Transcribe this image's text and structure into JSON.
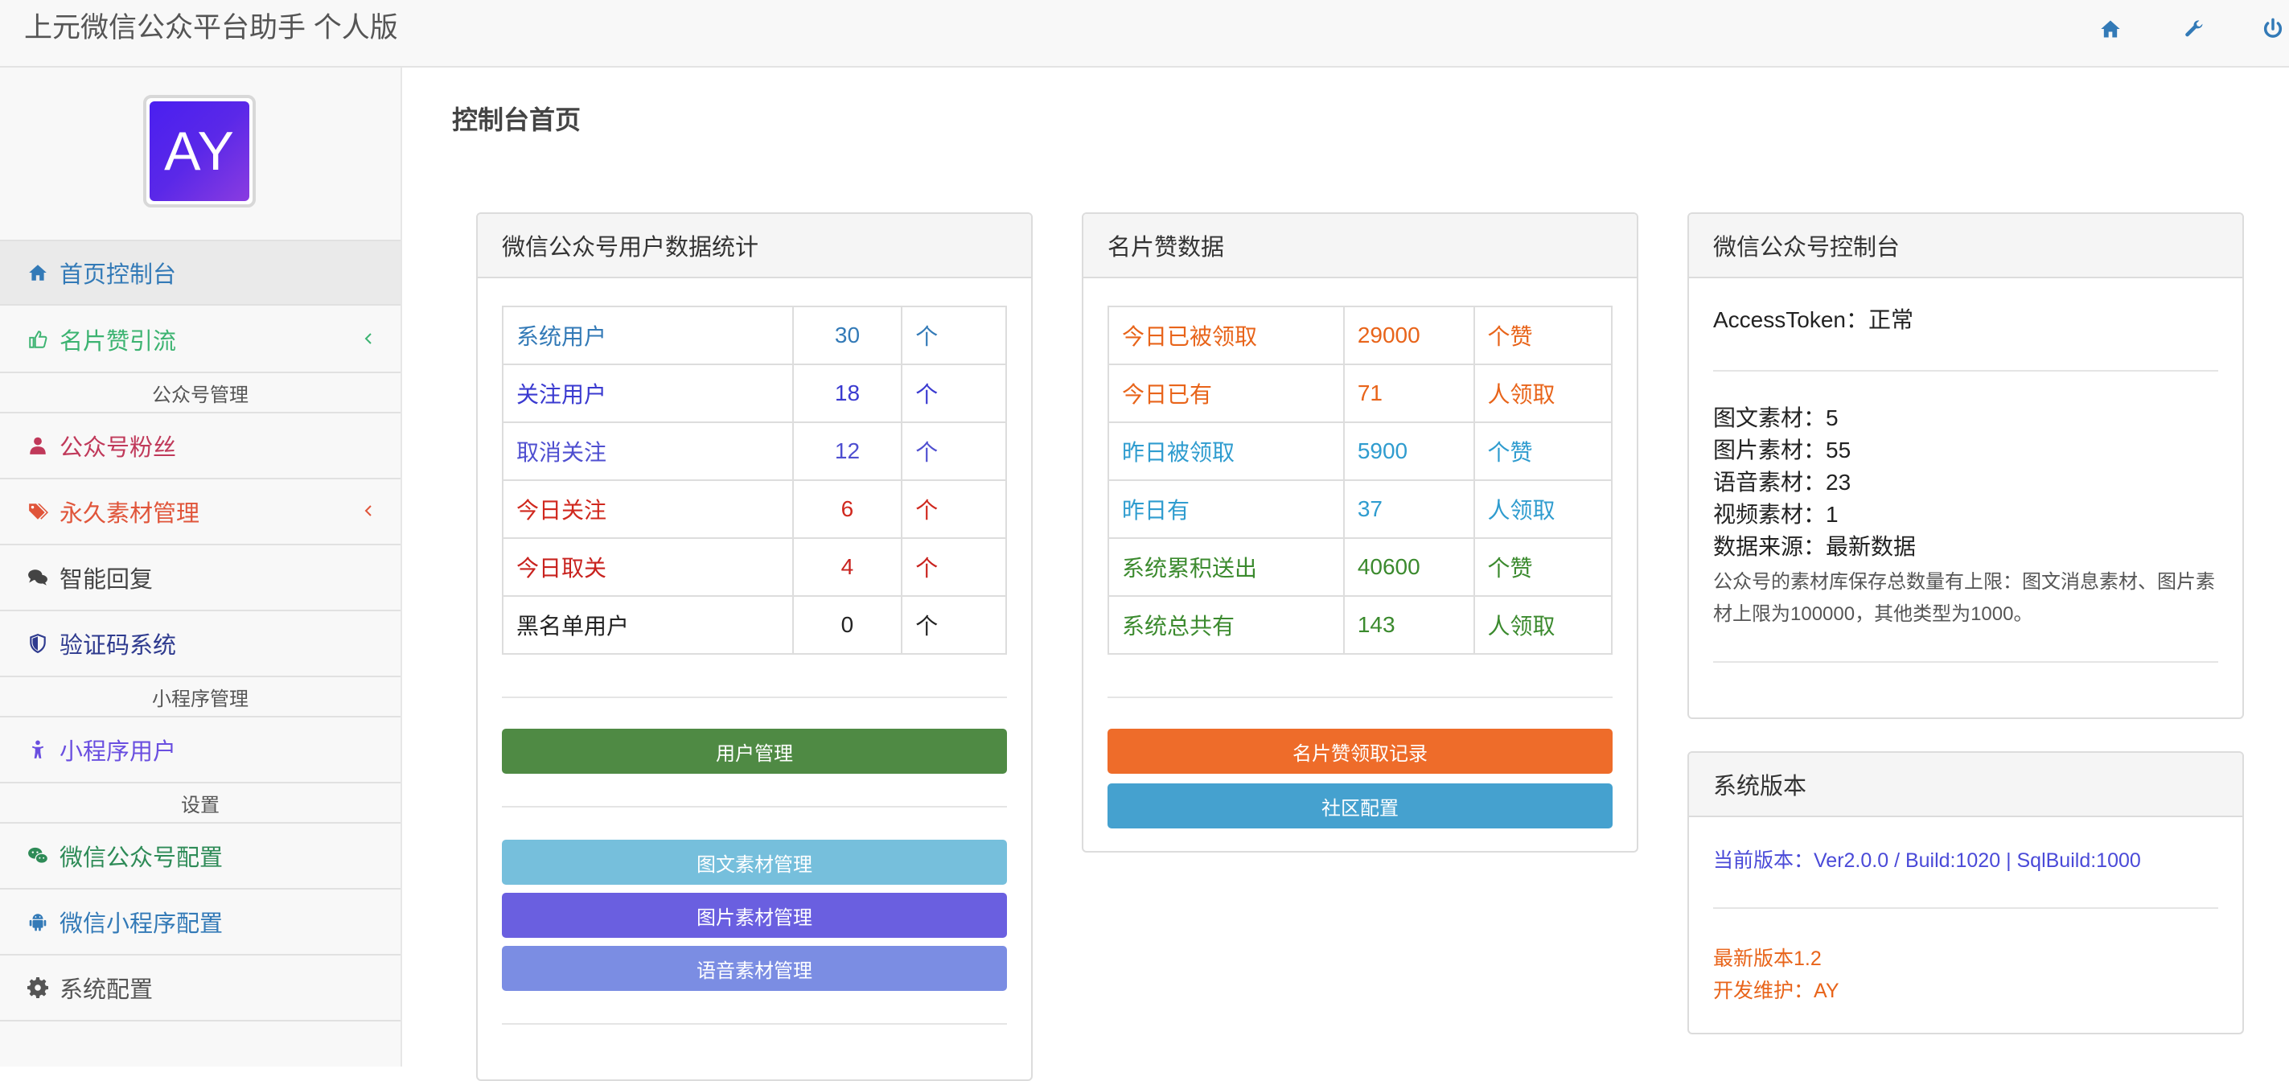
{
  "app": {
    "title": "上元微信公众平台助手 个人版"
  },
  "sidebar": {
    "logo_text": "AY",
    "items": [
      {
        "label": "首页控制台",
        "icon": "home-icon",
        "color": "#337ab7"
      },
      {
        "label": "名片赞引流",
        "icon": "thumbs-up-icon",
        "color": "#3cb371"
      },
      {
        "section": "公众号管理"
      },
      {
        "label": "公众号粉丝",
        "icon": "user-icon",
        "color": "#c0395a"
      },
      {
        "label": "永久素材管理",
        "icon": "tags-icon",
        "color": "#e0553a"
      },
      {
        "label": "智能回复",
        "icon": "comments-icon",
        "color": "#444444"
      },
      {
        "label": "验证码系统",
        "icon": "shield-icon",
        "color": "#2f3b8f"
      },
      {
        "section": "小程序管理"
      },
      {
        "label": "小程序用户",
        "icon": "child-icon",
        "color": "#6a4fe0"
      },
      {
        "section": "设置"
      },
      {
        "label": "微信公众号配置",
        "icon": "wechat-icon",
        "color": "#2e8b57"
      },
      {
        "label": "微信小程序配置",
        "icon": "android-icon",
        "color": "#337ab7"
      },
      {
        "label": "系统配置",
        "icon": "gear-icon",
        "color": "#555555"
      }
    ]
  },
  "main": {
    "page_title": "控制台首页",
    "user_stats": {
      "title": "微信公众号用户数据统计",
      "rows": [
        {
          "label": "系统用户",
          "value": "30",
          "unit": "个",
          "color": "#337ab7"
        },
        {
          "label": "关注用户",
          "value": "18",
          "unit": "个",
          "color": "#3a3ad0"
        },
        {
          "label": "取消关注",
          "value": "12",
          "unit": "个",
          "color": "#4f4fd0"
        },
        {
          "label": "今日关注",
          "value": "6",
          "unit": "个",
          "color": "#d0281e"
        },
        {
          "label": "今日取关",
          "value": "4",
          "unit": "个",
          "color": "#c8221e"
        },
        {
          "label": "黑名单用户",
          "value": "0",
          "unit": "个",
          "color": "#222222"
        }
      ],
      "buttons": [
        {
          "label": "用户管理",
          "color": "#4f8a44"
        },
        {
          "label": "图文素材管理",
          "color": "#76bfdc"
        },
        {
          "label": "图片素材管理",
          "color": "#6a5fe0"
        },
        {
          "label": "语音素材管理",
          "color": "#7b8de3"
        }
      ]
    },
    "card_likes": {
      "title": "名片赞数据",
      "rows": [
        {
          "label": "今日已被领取",
          "value": "29000",
          "unit": "个赞",
          "color": "#e8641a"
        },
        {
          "label": "今日已有",
          "value": "71",
          "unit": "人领取",
          "color": "#e8641a"
        },
        {
          "label": "昨日被领取",
          "value": "5900",
          "unit": "个赞",
          "color": "#2f9ccf"
        },
        {
          "label": "昨日有",
          "value": "37",
          "unit": "人领取",
          "color": "#2f9ccf"
        },
        {
          "label": "系统累积送出",
          "value": "40600",
          "unit": "个赞",
          "color": "#3b8a2e"
        },
        {
          "label": "系统总共有",
          "value": "143",
          "unit": "人领取",
          "color": "#3b8a2e"
        }
      ],
      "buttons": [
        {
          "label": "名片赞领取记录",
          "color": "#ee6c2a"
        },
        {
          "label": "社区配置",
          "color": "#45a1cf"
        }
      ]
    },
    "console": {
      "title": "微信公众号控制台",
      "access_token": "AccessToken：正常",
      "lines": [
        "图文素材：5",
        "图片素材：55",
        "语音素材：23",
        "视频素材：1",
        "数据来源：最新数据"
      ],
      "note": "公众号的素材库保存总数量有上限：图文消息素材、图片素材上限为100000，其他类型为1000。"
    },
    "version": {
      "title": "系统版本",
      "current": "当前版本：Ver2.0.0 / Build:1020 | SqlBuild:1000",
      "latest": "最新版本1.2",
      "maintainer": "开发维护：AY"
    }
  }
}
